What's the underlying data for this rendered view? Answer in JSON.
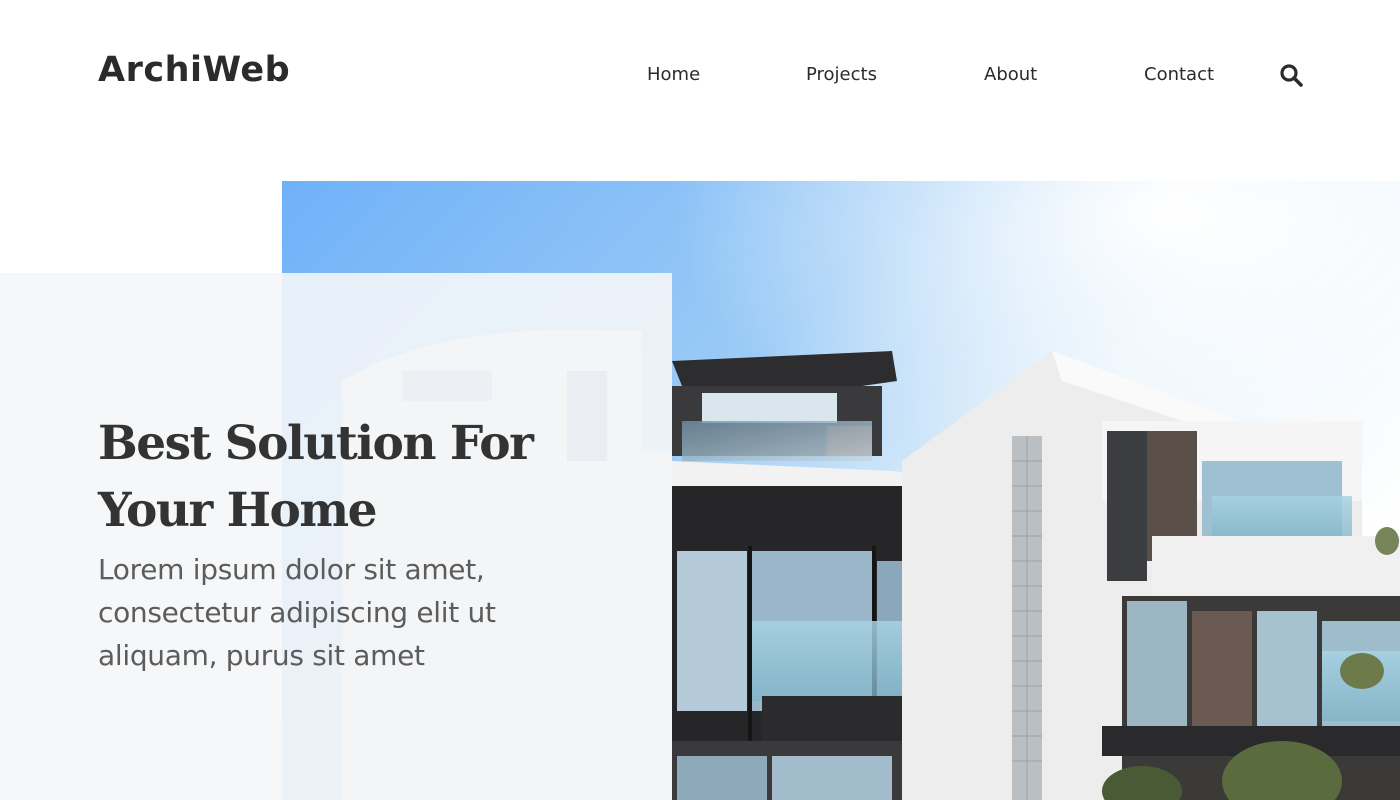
{
  "brand": {
    "logo_text": "ArchiWeb"
  },
  "nav": {
    "items": [
      {
        "label": "Home"
      },
      {
        "label": "Projects"
      },
      {
        "label": "About"
      },
      {
        "label": "Contact"
      }
    ],
    "search_icon": "search-icon"
  },
  "hero": {
    "title": "Best Solution For Your Home",
    "subtitle": "Lorem ipsum dolor sit amet, consectetur adipiscing elit ut aliquam, purus sit amet",
    "image": "modern-house-photo"
  },
  "colors": {
    "text_dark": "#2b2b2b",
    "text_muted": "#5c5c5c",
    "panel": "#f4f6f8",
    "sky": "#7ab8f5"
  }
}
